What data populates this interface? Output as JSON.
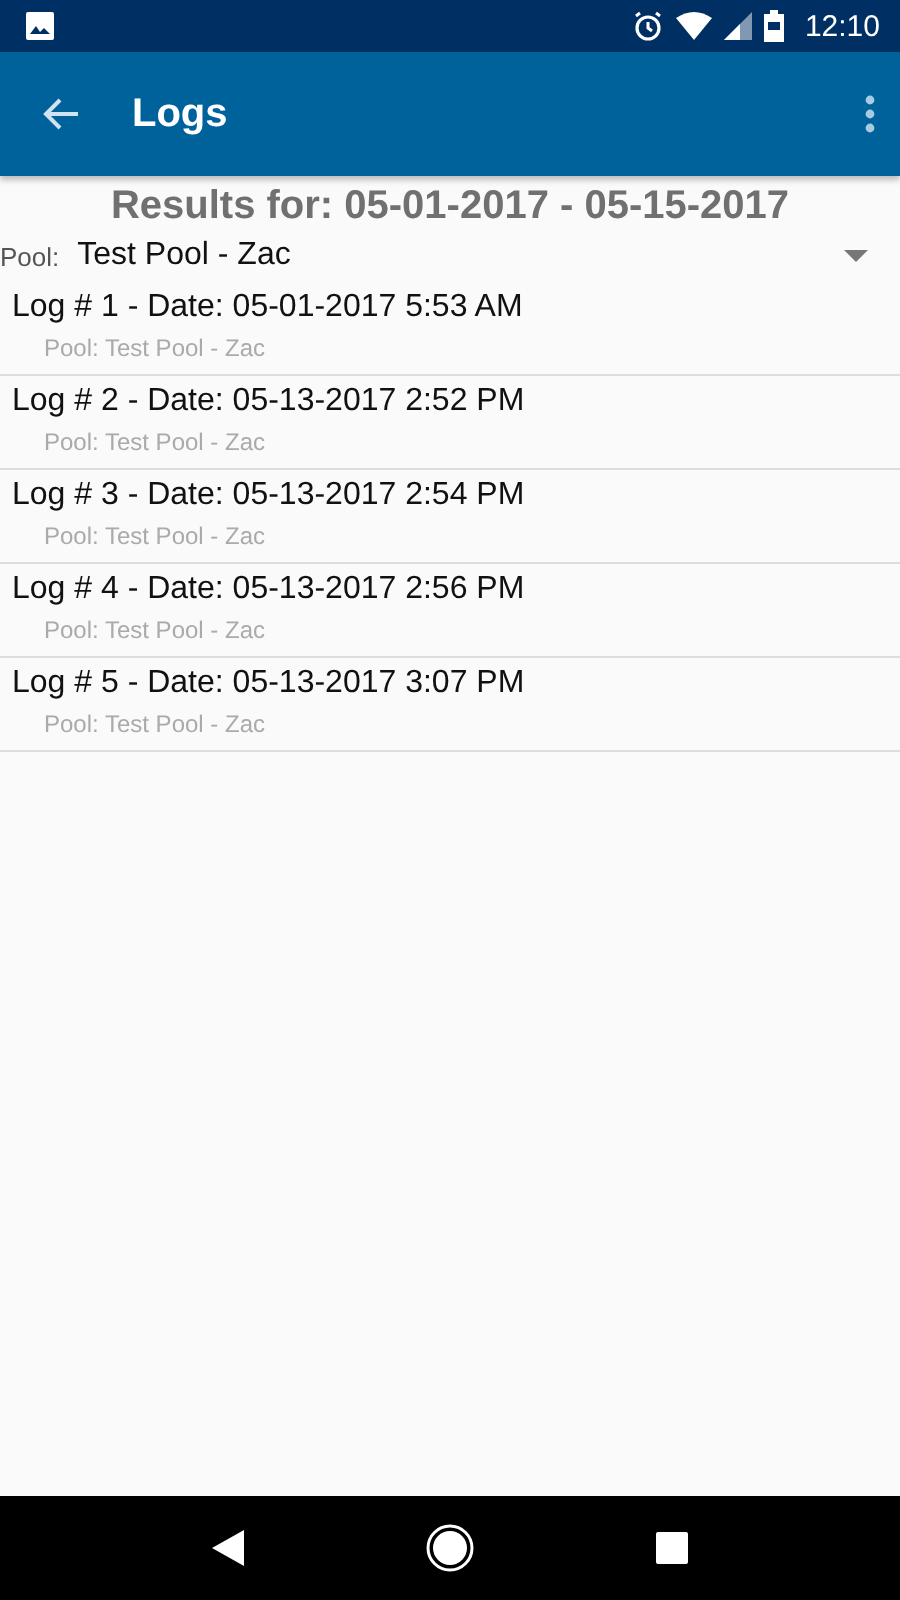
{
  "status_bar": {
    "time": "12:10"
  },
  "toolbar": {
    "title": "Logs"
  },
  "results_heading": "Results for: 05-01-2017 - 05-15-2017",
  "pool_selector": {
    "label": "Pool:",
    "value": "Test Pool - Zac"
  },
  "logs": [
    {
      "title": "Log # 1 - Date: 05-01-2017 5:53 AM",
      "subtitle": "Pool: Test Pool - Zac"
    },
    {
      "title": "Log # 2 - Date: 05-13-2017 2:52 PM",
      "subtitle": "Pool: Test Pool - Zac"
    },
    {
      "title": "Log # 3 - Date: 05-13-2017 2:54 PM",
      "subtitle": "Pool: Test Pool - Zac"
    },
    {
      "title": "Log # 4 - Date: 05-13-2017 2:56 PM",
      "subtitle": "Pool: Test Pool - Zac"
    },
    {
      "title": "Log # 5 - Date: 05-13-2017 3:07 PM",
      "subtitle": "Pool: Test Pool - Zac"
    }
  ]
}
